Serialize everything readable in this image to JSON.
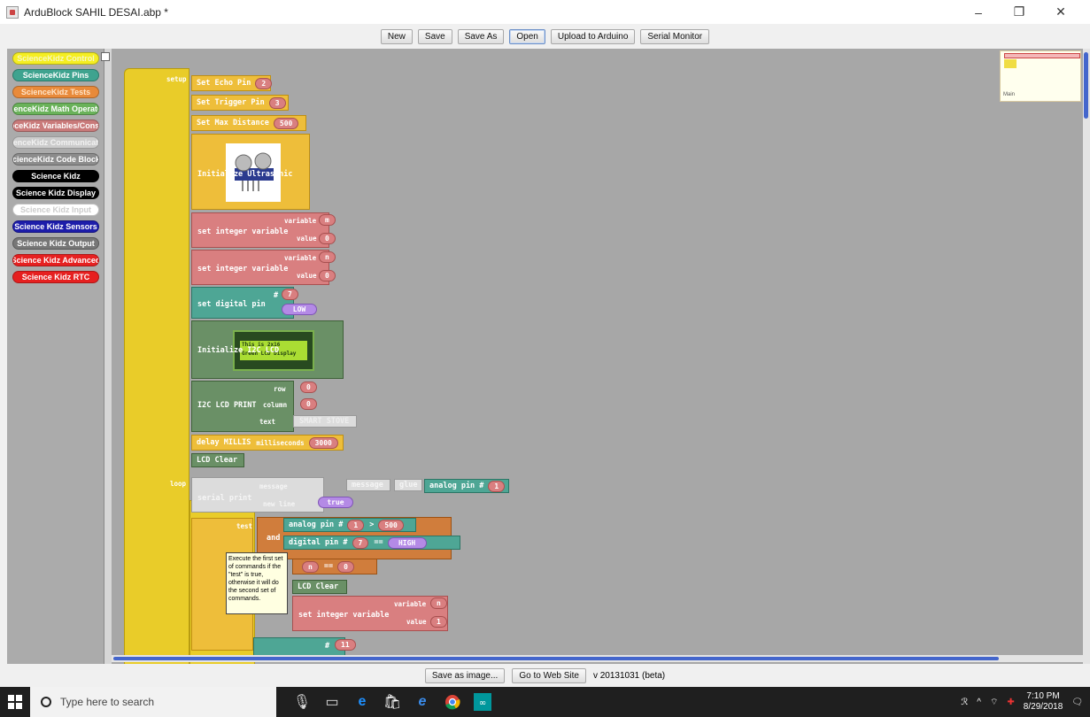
{
  "window": {
    "title": "ArduBlock SAHIL DESAI.abp *",
    "controls": {
      "minimize": "–",
      "maximize": "❐",
      "close": "✕"
    }
  },
  "toolbar": {
    "buttons": [
      "New",
      "Save",
      "Save As",
      "Open",
      "Upload to Arduino",
      "Serial Monitor"
    ]
  },
  "palette": {
    "categories": [
      {
        "label": "ScienceKidz Control",
        "color": "#f5ee22",
        "text": "#f7f7c0"
      },
      {
        "label": "ScienceKidz Pins",
        "color": "#3ea38f",
        "text": "#ffffff"
      },
      {
        "label": "ScienceKidz Tests",
        "color": "#e88a3a",
        "text": "#ffe4c8"
      },
      {
        "label": "ScienceKidz Math Operators",
        "color": "#6ab25a",
        "text": "#ffffff"
      },
      {
        "label": "ScienceKidz Variables/Constants",
        "color": "#c97a7a",
        "text": "#ffffff"
      },
      {
        "label": "ScienceKidz Communication",
        "color": "#cccccc",
        "text": "#f2f2f2"
      },
      {
        "label": "ScienceKidz Code Blocks",
        "color": "#8c8c8c",
        "text": "#ffffff"
      },
      {
        "label": "Science Kidz",
        "color": "#000000",
        "text": "#ffffff"
      },
      {
        "label": "Science Kidz Display",
        "color": "#000000",
        "text": "#ffffff"
      },
      {
        "label": "Science Kidz Input",
        "color": "#ffffff",
        "text": "#cccccc"
      },
      {
        "label": "Science Kidz Sensors",
        "color": "#1d1daa",
        "text": "#ffffff"
      },
      {
        "label": "Science Kidz Output",
        "color": "#777777",
        "text": "#ffffff"
      },
      {
        "label": "Science Kidz Advanced",
        "color": "#e62020",
        "text": "#ffffff"
      },
      {
        "label": "Science Kidz RTC",
        "color": "#e62020",
        "text": "#ffffff"
      }
    ]
  },
  "canvas": {
    "minimap_label": "Main",
    "setup": {
      "label": "setup",
      "set_echo_pin": {
        "label": "Set Echo Pin",
        "value": "2"
      },
      "set_trigger_pin": {
        "label": "Set Trigger Pin",
        "value": "3"
      },
      "set_max_distance": {
        "label": "Set Max Distance",
        "value": "500"
      },
      "initialize_ultrasonic": "Initialize Ultrasonic",
      "set_int_1": {
        "label": "set integer variable",
        "variable_label": "variable",
        "variable": "m",
        "value_label": "value",
        "value": "0"
      },
      "set_int_2": {
        "label": "set integer variable",
        "variable_label": "variable",
        "variable": "n",
        "value_label": "value",
        "value": "0"
      },
      "set_digital_pin": {
        "label": "set digital pin",
        "pin_label": "#",
        "pin": "7",
        "state": "LOW"
      },
      "initialize_lcd": "Initialize I2C LCD",
      "lcd_image_text": {
        "line1": "This is 2x16",
        "line2": "Green LCD Display"
      },
      "lcd_print": {
        "label": "I2C LCD PRINT",
        "row_label": "row",
        "row": "0",
        "column_label": "column",
        "column": "0",
        "text_label": "text",
        "text": "SMART STOVE"
      },
      "delay": {
        "label": "delay MILLIS",
        "ms_label": "milliseconds",
        "value": "3000"
      },
      "lcd_clear": "LCD Clear"
    },
    "loop": {
      "label": "loop",
      "serial_print": {
        "label": "serial print",
        "message_label": "message",
        "glue_message": "message",
        "glue_label": "glue",
        "analog_label": "analog pin #",
        "analog_pin": "1",
        "newline_label": "new line",
        "newline": "true"
      },
      "if_test_label": "test",
      "and_label": "and",
      "cond1": {
        "label": "analog pin #",
        "pin": "1",
        "op": ">",
        "value": "500"
      },
      "cond2": {
        "label": "digital pin #",
        "pin": "7",
        "op": "==",
        "value": "HIGH"
      },
      "cond3": {
        "var": "n",
        "op": "==",
        "value": "0"
      },
      "lcd_clear": "LCD Clear",
      "set_int": {
        "label": "set integer variable",
        "variable_label": "variable",
        "variable": "n",
        "value_label": "value",
        "value": "1"
      },
      "bottom_pin": {
        "pin_label": "#",
        "pin": "11"
      }
    },
    "tooltip": "Execute the first set of commands if the \"test\" is true, otherwise it will do the second set of commands."
  },
  "bottombar": {
    "save_image": "Save as image...",
    "website": "Go to Web Site",
    "version": "v 20131031 (beta)"
  },
  "taskbar": {
    "search_placeholder": "Type here to search",
    "time": "7:10 PM",
    "date": "8/29/2018"
  }
}
